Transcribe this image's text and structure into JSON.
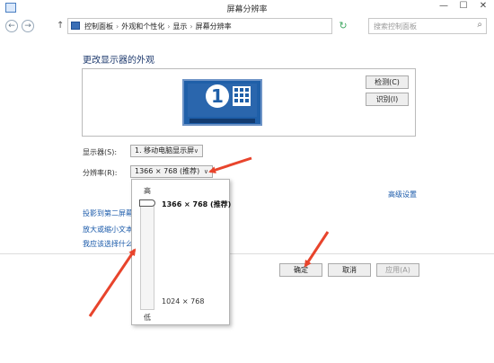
{
  "window": {
    "title": "屏幕分辨率",
    "controls": {
      "minimize": "—",
      "maximize": "☐",
      "close": "✕"
    }
  },
  "nav": {
    "back": "←",
    "forward": "→",
    "up": "↑",
    "breadcrumb": [
      "控制面板",
      "外观和个性化",
      "显示",
      "屏幕分辨率"
    ],
    "separator": "›",
    "refresh": "↻",
    "search_placeholder": "搜索控制面板"
  },
  "main": {
    "heading": "更改显示器的外观",
    "monitor_number": "1",
    "detect_button": "检测(C)",
    "identify_button": "识别(I)",
    "display_label": "显示器(S):",
    "display_value": "1. 移动电脑显示屏",
    "resolution_label": "分辨率(R):",
    "resolution_value": "1366 × 768 (推荐)",
    "advanced_link": "高级设置",
    "links": [
      "投影到第二屏幕",
      "放大或缩小文本",
      "我应该选择什么"
    ]
  },
  "footer": {
    "ok_button": "确定",
    "cancel_button": "取消",
    "apply_button": "应用(A)"
  },
  "resolution_popup": {
    "high_label": "高",
    "low_label": "低",
    "max_resolution": "1366 × 768 (推荐)",
    "min_resolution": "1024 × 768",
    "slider_level": 1.0
  },
  "colors": {
    "accent": "#1f5fa8",
    "link": "#1a5aaa",
    "annotation_arrow": "#e8442c"
  },
  "icons": [
    "control-panel-icon",
    "search-icon",
    "refresh-icon",
    "back-arrow-icon",
    "forward-arrow-icon",
    "monitor-icon"
  ]
}
